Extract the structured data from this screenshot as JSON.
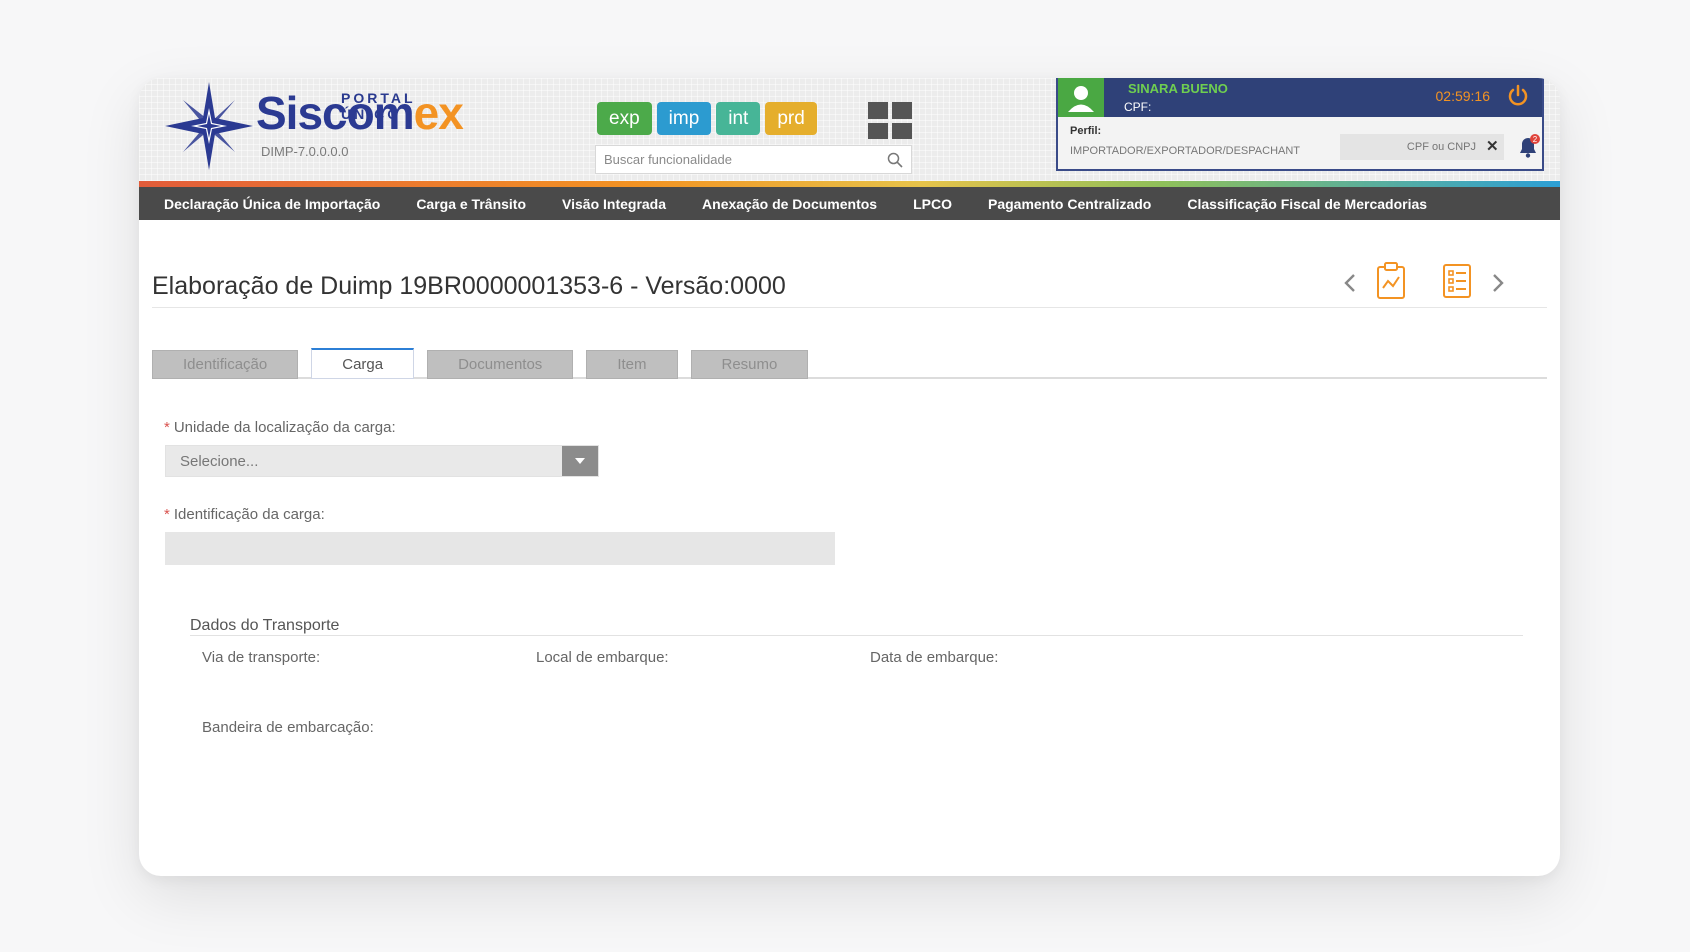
{
  "logo": {
    "portal": "PORTAL ÚNICO",
    "name_main": "Siscom",
    "name_accent": "ex",
    "version": "DIMP-7.0.0.0.0"
  },
  "modules": [
    {
      "label": "exp",
      "color": "#4caa4a"
    },
    {
      "label": "imp",
      "color": "#2c9bd0"
    },
    {
      "label": "int",
      "color": "#47b597"
    },
    {
      "label": "prd",
      "color": "#e5ae2c"
    }
  ],
  "search": {
    "placeholder": "Buscar funcionalidade"
  },
  "user": {
    "name": "SINARA BUENO",
    "cpf_label": "CPF:",
    "time": "02:59:16",
    "perfil_label": "Perfil:",
    "perfil_value": "IMPORTADOR/EXPORTADOR/DESPACHANT",
    "cpf_cnpj_placeholder": "CPF ou CNPJ",
    "notification_count": "2"
  },
  "nav": [
    "Declaração Única de Importação",
    "Carga e Trânsito",
    "Visão Integrada",
    "Anexação de Documentos",
    "LPCO",
    "Pagamento Centralizado",
    "Classificação Fiscal de Mercadorias"
  ],
  "page": {
    "title": "Elaboração de Duimp 19BR0000001353-6 - Versão:0000"
  },
  "tabs": [
    {
      "label": "Identificação",
      "active": false
    },
    {
      "label": "Carga",
      "active": true
    },
    {
      "label": "Documentos",
      "active": false
    },
    {
      "label": "Item",
      "active": false
    },
    {
      "label": "Resumo",
      "active": false
    }
  ],
  "form": {
    "required_mark": "*",
    "unidade_label": "Unidade da localização da carga:",
    "unidade_value": "Selecione...",
    "identificacao_label": "Identificação da carga:",
    "identificacao_value": ""
  },
  "transporte": {
    "title": "Dados do Transporte",
    "via_label": "Via de transporte:",
    "local_label": "Local de embarque:",
    "data_label": "Data de embarque:",
    "bandeira_label": "Bandeira de embarcação:"
  },
  "colors": {
    "brand_blue": "#2b3a92",
    "brand_orange": "#f39323",
    "nav_bg": "#4a4a4a",
    "accent_green": "#4aa843"
  }
}
